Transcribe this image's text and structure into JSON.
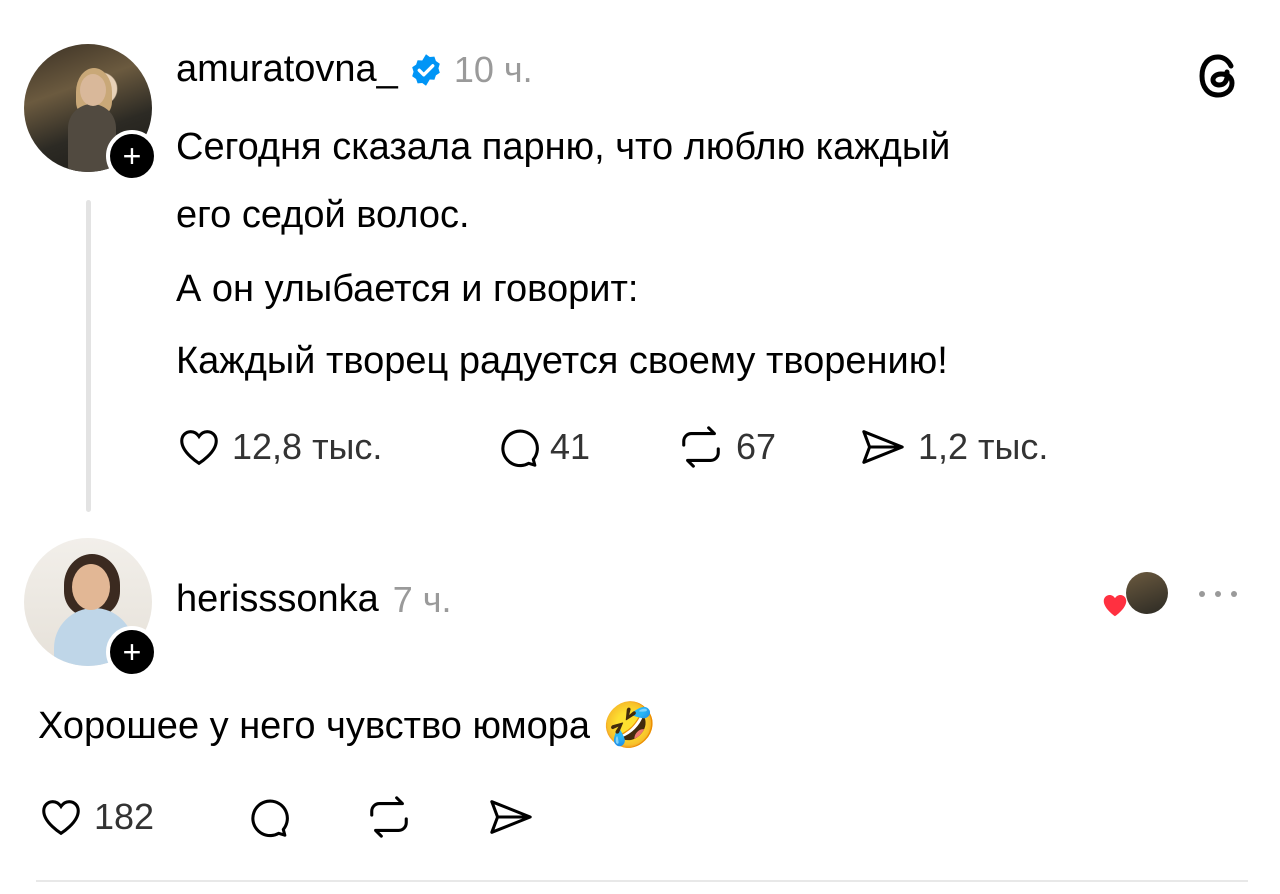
{
  "post": {
    "username": "amuratovna_",
    "time": "10 ч.",
    "lines": [
      "Сегодня сказала парню, что люблю каждый",
      "его седой волос.",
      "А он улыбается и говорит:",
      "Каждый творец радуется своему творению!"
    ],
    "likes": "12,8 тыс.",
    "comments": "41",
    "reposts": "67",
    "shares": "1,2 тыс."
  },
  "reply": {
    "username": "herisssonka",
    "time": "7 ч.",
    "text": "Хорошее у него чувство юмора",
    "emoji": "🤣",
    "likes": "182"
  },
  "colors": {
    "verified": "#0095f6",
    "heart": "#ff3040"
  },
  "icons": [
    "threads-logo-icon",
    "verified-badge-icon",
    "heart-icon",
    "comment-icon",
    "repost-icon",
    "share-icon",
    "more-icon",
    "plus-icon"
  ]
}
